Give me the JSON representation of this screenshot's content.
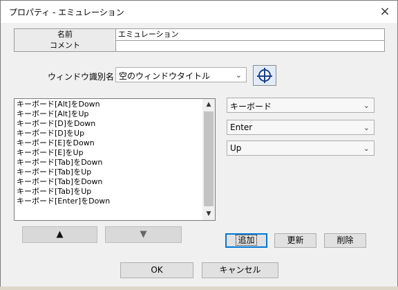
{
  "window": {
    "title": "プロパティ - エミュレーション",
    "close_glyph": "×"
  },
  "properties": {
    "rows": [
      {
        "label": "名前",
        "value": "エミュレーション"
      },
      {
        "label": "コメント",
        "value": ""
      }
    ]
  },
  "window_id": {
    "label": "ウィンドウ識別名",
    "selected": "空のウィンドウタイトル",
    "arrow": "⌄",
    "target_icon": "crosshair-target-icon"
  },
  "actions_list": {
    "items": [
      "キーボード[Alt]をDown",
      "キーボード[Alt]をUp",
      "キーボード[D]をDown",
      "キーボード[D]をUp",
      "キーボード[E]をDown",
      "キーボード[E]をUp",
      "キーボード[Tab]をDown",
      "キーボード[Tab]をUp",
      "キーボード[Tab]をDown",
      "キーボード[Tab]をUp",
      "キーボード[Enter]をDown"
    ],
    "scroll_up_glyph": "▲",
    "scroll_down_glyph": "▼"
  },
  "editor": {
    "device": "キーボード",
    "key": "Enter",
    "direction": "Up"
  },
  "move_buttons": {
    "up_glyph": "▲",
    "down_glyph": "▼"
  },
  "edit_buttons": {
    "add": "追加",
    "update": "更新",
    "delete": "削除"
  },
  "dialog_buttons": {
    "ok": "OK",
    "cancel": "キャンセル"
  }
}
